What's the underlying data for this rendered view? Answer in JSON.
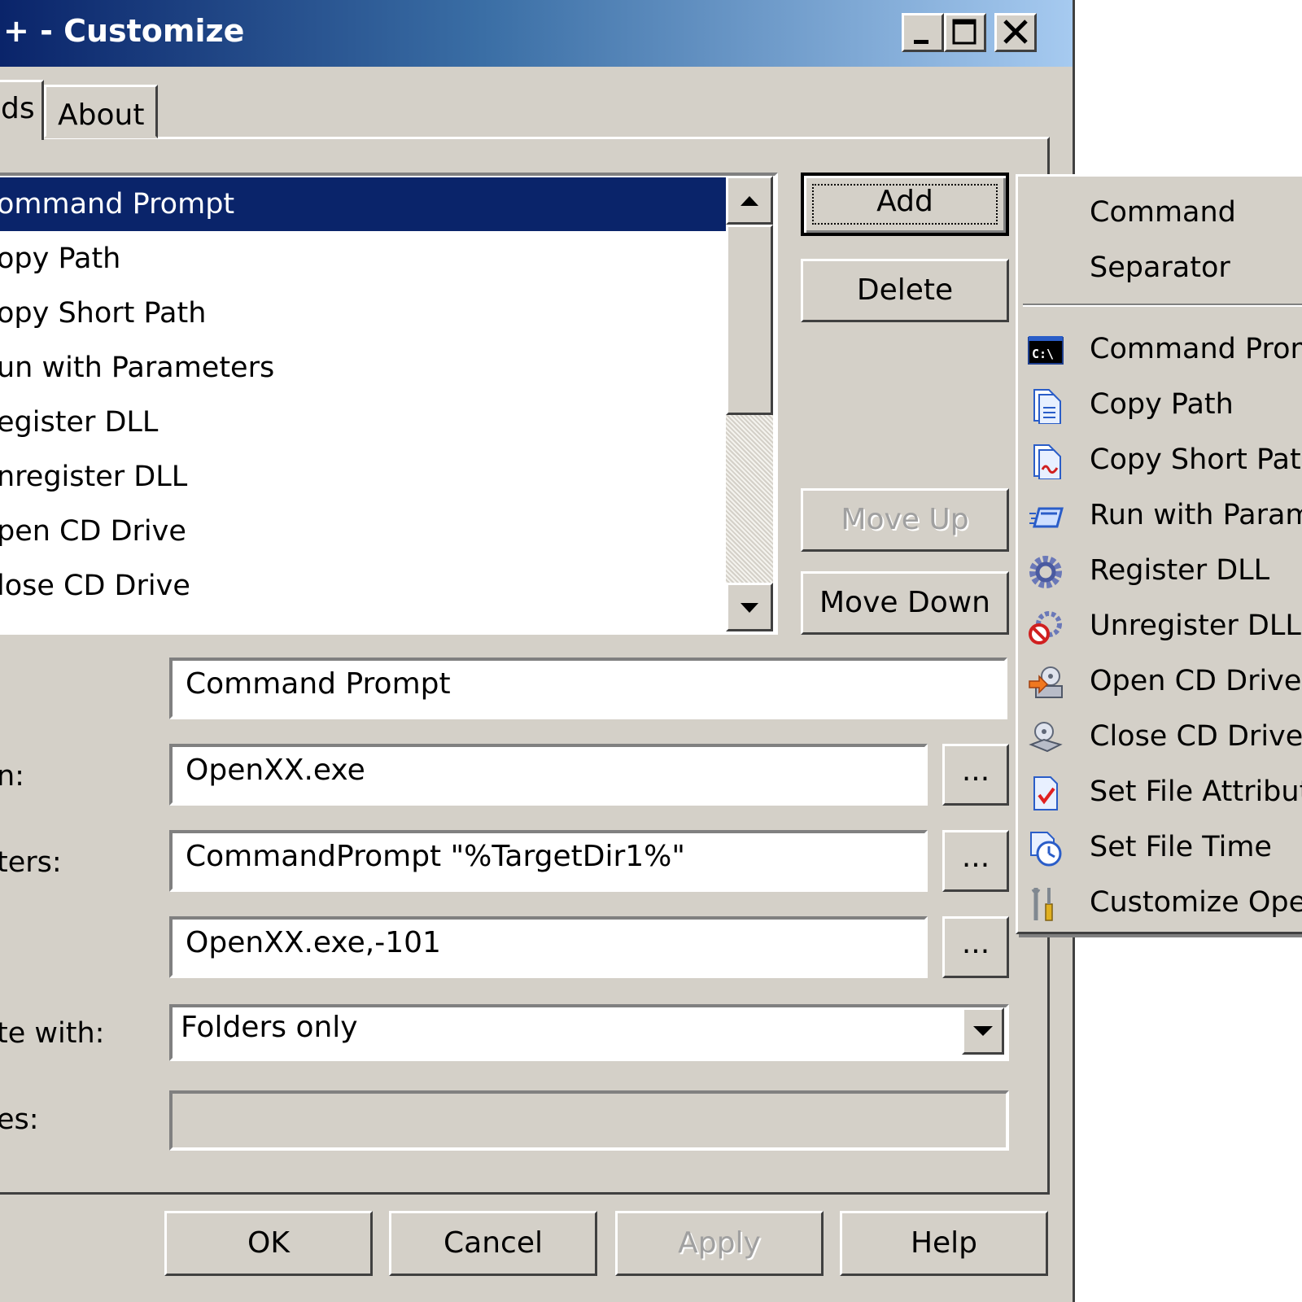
{
  "window": {
    "title": "+ - Customize",
    "tabs": [
      "ds",
      "About"
    ]
  },
  "commands_list": {
    "items": [
      "ommand Prompt",
      "opy Path",
      "opy Short Path",
      "un with Parameters",
      "egister DLL",
      "nregister DLL",
      "pen CD Drive",
      "lose CD Drive"
    ],
    "selected_index": 0
  },
  "side_buttons": {
    "add": "Add",
    "delete": "Delete",
    "move_up": "Move Up",
    "move_down": "Move Down"
  },
  "form": {
    "labels": {
      "program": "n:",
      "parameters": "ters:",
      "activate": "te with:",
      "extensions": "es:"
    },
    "name_value": "Command Prompt",
    "program_value": "OpenXX.exe",
    "parameters_value": "CommandPrompt \"%TargetDir1%\"",
    "icon_value": "OpenXX.exe,-101",
    "activate_value": "Folders only",
    "extensions_value": "",
    "browse_label": "..."
  },
  "bottom_buttons": {
    "ok": "OK",
    "cancel": "Cancel",
    "apply": "Apply",
    "help": "Help"
  },
  "add_menu": {
    "top_items": [
      "Command",
      "Separator"
    ],
    "items": [
      {
        "label": "Command Promp",
        "icon": "command-prompt-icon"
      },
      {
        "label": "Copy Path",
        "icon": "copy-path-icon"
      },
      {
        "label": "Copy Short Path",
        "icon": "copy-short-path-icon"
      },
      {
        "label": "Run with Parame",
        "icon": "run-with-parameters-icon"
      },
      {
        "label": "Register DLL",
        "icon": "register-dll-icon"
      },
      {
        "label": "Unregister DLL",
        "icon": "unregister-dll-icon"
      },
      {
        "label": "Open CD Drive",
        "icon": "open-cd-drive-icon"
      },
      {
        "label": "Close CD Drive",
        "icon": "close-cd-drive-icon"
      },
      {
        "label": "Set File Attribute",
        "icon": "set-file-attributes-icon"
      },
      {
        "label": "Set File Time",
        "icon": "set-file-time-icon"
      },
      {
        "label": "Customize Open",
        "icon": "customize-icon"
      }
    ]
  }
}
